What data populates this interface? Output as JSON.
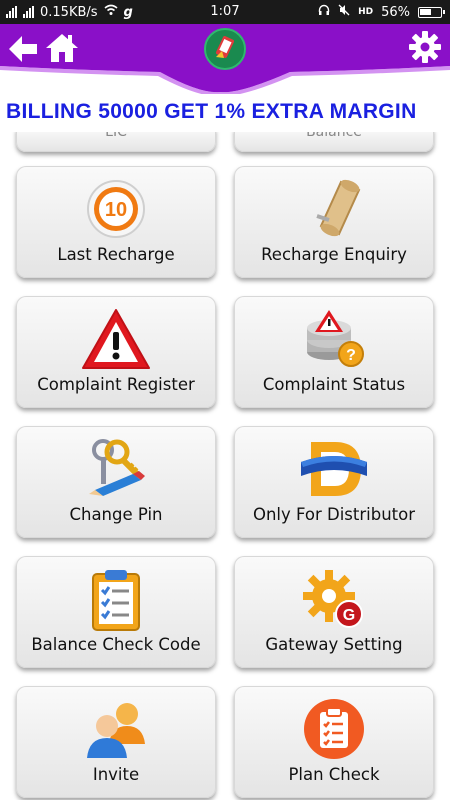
{
  "status_bar": {
    "network_speed": "0.15KB/s",
    "carrier_glyph": "g",
    "time": "1:07",
    "battery": "56%"
  },
  "header": {
    "back_icon": "back-arrow-icon",
    "home_icon": "home-icon",
    "settings_icon": "gear-icon",
    "accent_color": "#8a10c8"
  },
  "banner": {
    "text": "BILLING 50000 GET 1% EXTRA MARGIN",
    "color": "#1a20e0"
  },
  "menu": {
    "partial_left": "LIC",
    "partial_right": "Balance",
    "items": [
      {
        "label": "Last Recharge",
        "icon": "orange-ten-badge-icon"
      },
      {
        "label": "Recharge Enquiry",
        "icon": "scroll-icon"
      },
      {
        "label": "Complaint Register",
        "icon": "warning-triangle-icon"
      },
      {
        "label": "Complaint Status",
        "icon": "database-warning-icon"
      },
      {
        "label": "Change Pin",
        "icon": "keys-pencil-icon"
      },
      {
        "label": "Only For Distributor",
        "icon": "distributor-d-icon"
      },
      {
        "label": "Balance Check Code",
        "icon": "clipboard-checklist-icon"
      },
      {
        "label": "Gateway Setting",
        "icon": "gear-g-icon"
      },
      {
        "label": "Invite",
        "icon": "users-icon"
      },
      {
        "label": "Plan Check",
        "icon": "plan-clipboard-icon"
      }
    ]
  }
}
